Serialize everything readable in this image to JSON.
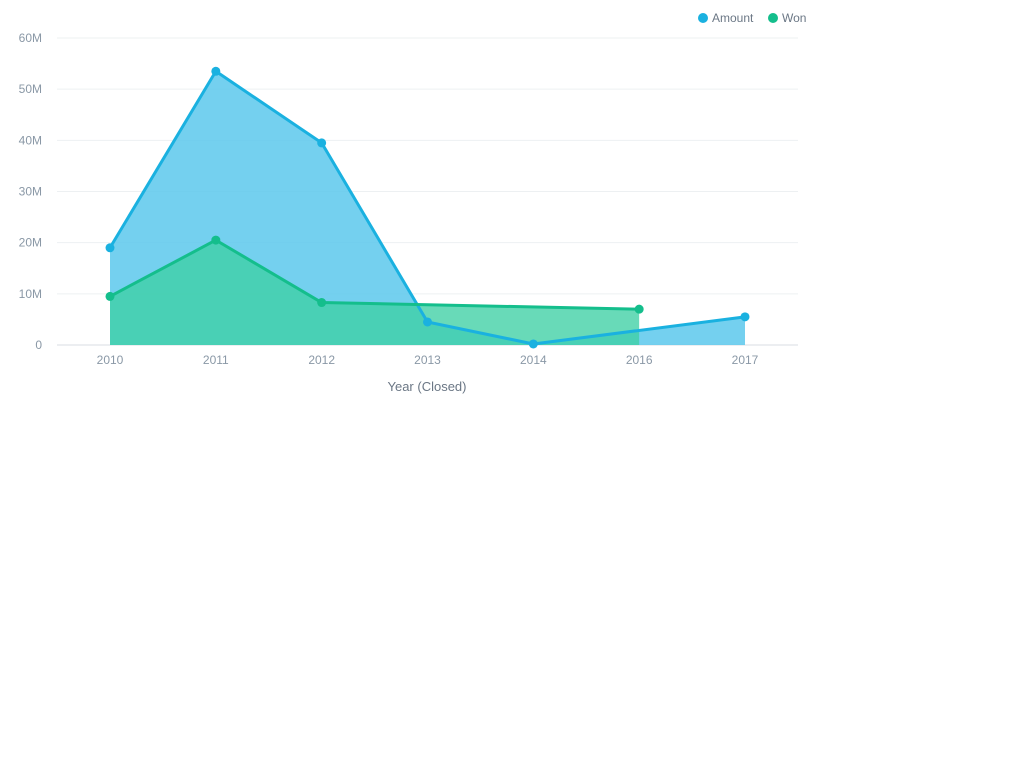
{
  "chart_data": {
    "type": "area",
    "xlabel": "Year (Closed)",
    "ylabel": "",
    "ylim": [
      0,
      60000000
    ],
    "y_ticks": [
      0,
      10000000,
      20000000,
      30000000,
      40000000,
      50000000,
      60000000
    ],
    "y_tick_labels": [
      "0",
      "10M",
      "20M",
      "30M",
      "40M",
      "50M",
      "60M"
    ],
    "categories": [
      "2010",
      "2011",
      "2012",
      "2013",
      "2014",
      "2016",
      "2017"
    ],
    "grid": true,
    "legend_position": "top-right",
    "series": [
      {
        "name": "Amount",
        "color": "#1ab1e0",
        "fill_color": "#5cc8ec",
        "values": [
          19000000,
          53500000,
          39500000,
          4500000,
          200000,
          null,
          5500000
        ]
      },
      {
        "name": "Won",
        "color": "#14be8c",
        "fill_color": "#3dcfa4",
        "values": [
          9500000,
          20500000,
          8300000,
          null,
          null,
          7000000,
          null
        ]
      }
    ]
  }
}
